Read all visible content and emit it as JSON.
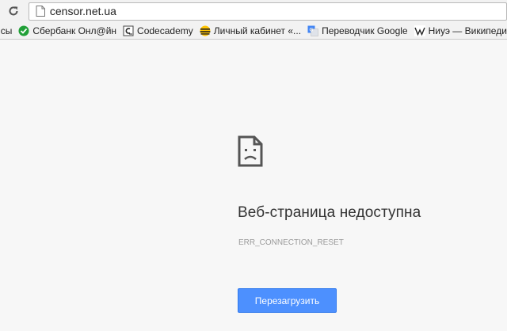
{
  "address_bar": {
    "url": "censor.net.ua"
  },
  "bookmarks": [
    {
      "label": "исы",
      "icon": "none"
    },
    {
      "label": "Сбербанк Онл@йн",
      "icon": "sberbank-icon"
    },
    {
      "label": "Codecademy",
      "icon": "codecademy-icon"
    },
    {
      "label": "Личный кабинет «...",
      "icon": "beeline-icon"
    },
    {
      "label": "Переводчик Google",
      "icon": "google-translate-icon"
    },
    {
      "label": "Ниуэ — Википедия",
      "icon": "wikipedia-icon"
    }
  ],
  "error_page": {
    "title": "Веб-страница недоступна",
    "code": "ERR_CONNECTION_RESET",
    "reload_label": "Перезагрузить"
  },
  "colors": {
    "button": "#4d90fe",
    "background": "#f7f7f7"
  }
}
